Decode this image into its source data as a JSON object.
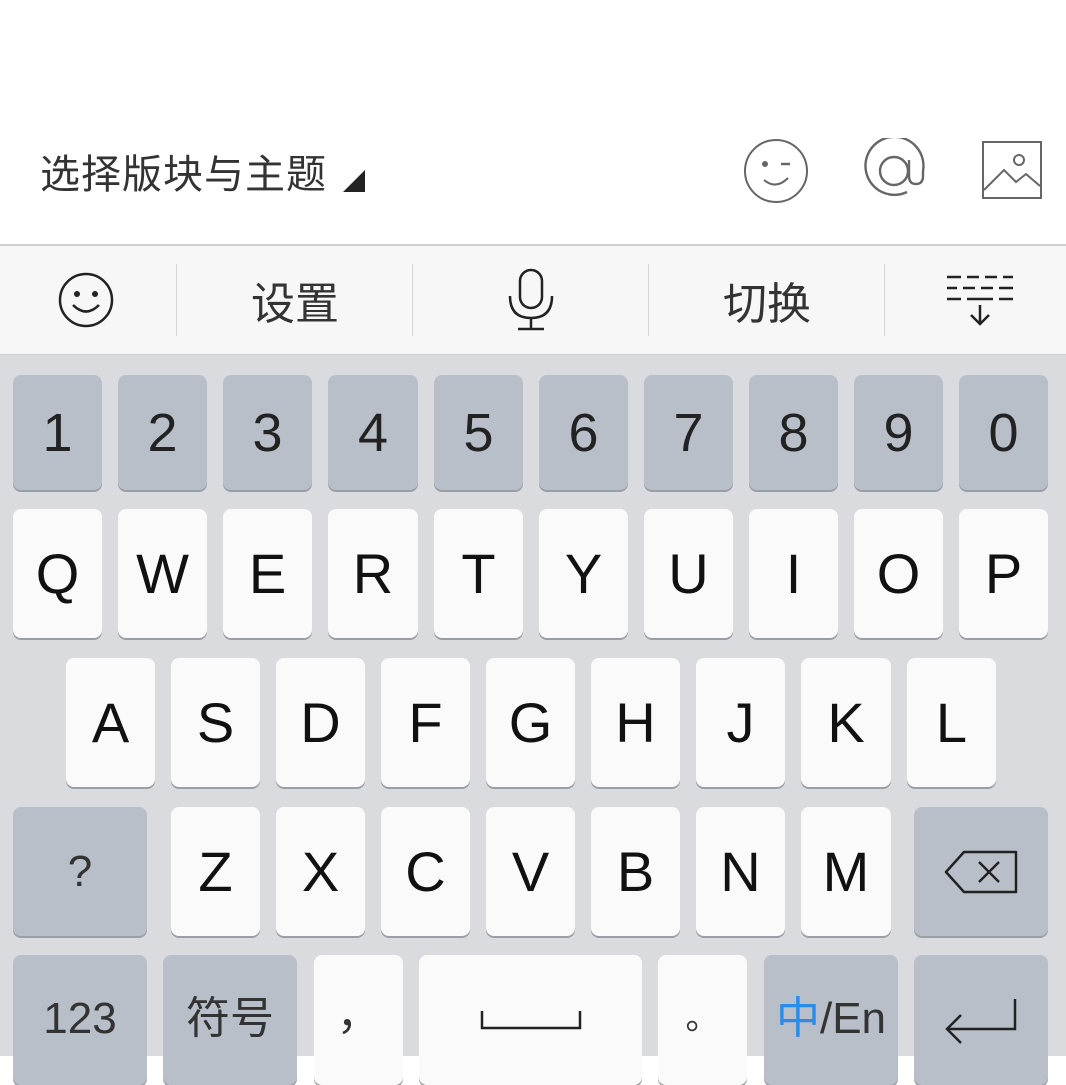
{
  "compose": {
    "forum_select_label": "选择版块与主题"
  },
  "icons": {
    "emoji": "smiley-wink-icon",
    "mention": "at-sign-icon",
    "image": "image-icon"
  },
  "toolbar": {
    "items": [
      {
        "icon": "emoji-icon"
      },
      {
        "label": "设置"
      },
      {
        "icon": "microphone-icon"
      },
      {
        "label": "切换"
      },
      {
        "icon": "hide-keyboard-icon"
      }
    ]
  },
  "keyboard": {
    "number_row": [
      "1",
      "2",
      "3",
      "4",
      "5",
      "6",
      "7",
      "8",
      "9",
      "0"
    ],
    "row1": [
      "Q",
      "W",
      "E",
      "R",
      "T",
      "Y",
      "U",
      "I",
      "O",
      "P"
    ],
    "row2": [
      "A",
      "S",
      "D",
      "F",
      "G",
      "H",
      "J",
      "K",
      "L"
    ],
    "row3": [
      "Z",
      "X",
      "C",
      "V",
      "B",
      "N",
      "M"
    ],
    "question_key": "?",
    "num_switch": "123",
    "symbols": "符号",
    "comma": "，",
    "period": "。",
    "lang_zh": "中",
    "lang_rest": "/En",
    "backspace_icon": "backspace-icon",
    "enter_icon": "return-icon"
  },
  "colors": {
    "accent": "#2b8be8",
    "keyboard_bg": "#d9dbde",
    "key_gray": "#b9bfc9",
    "key_white": "#fafafa"
  }
}
